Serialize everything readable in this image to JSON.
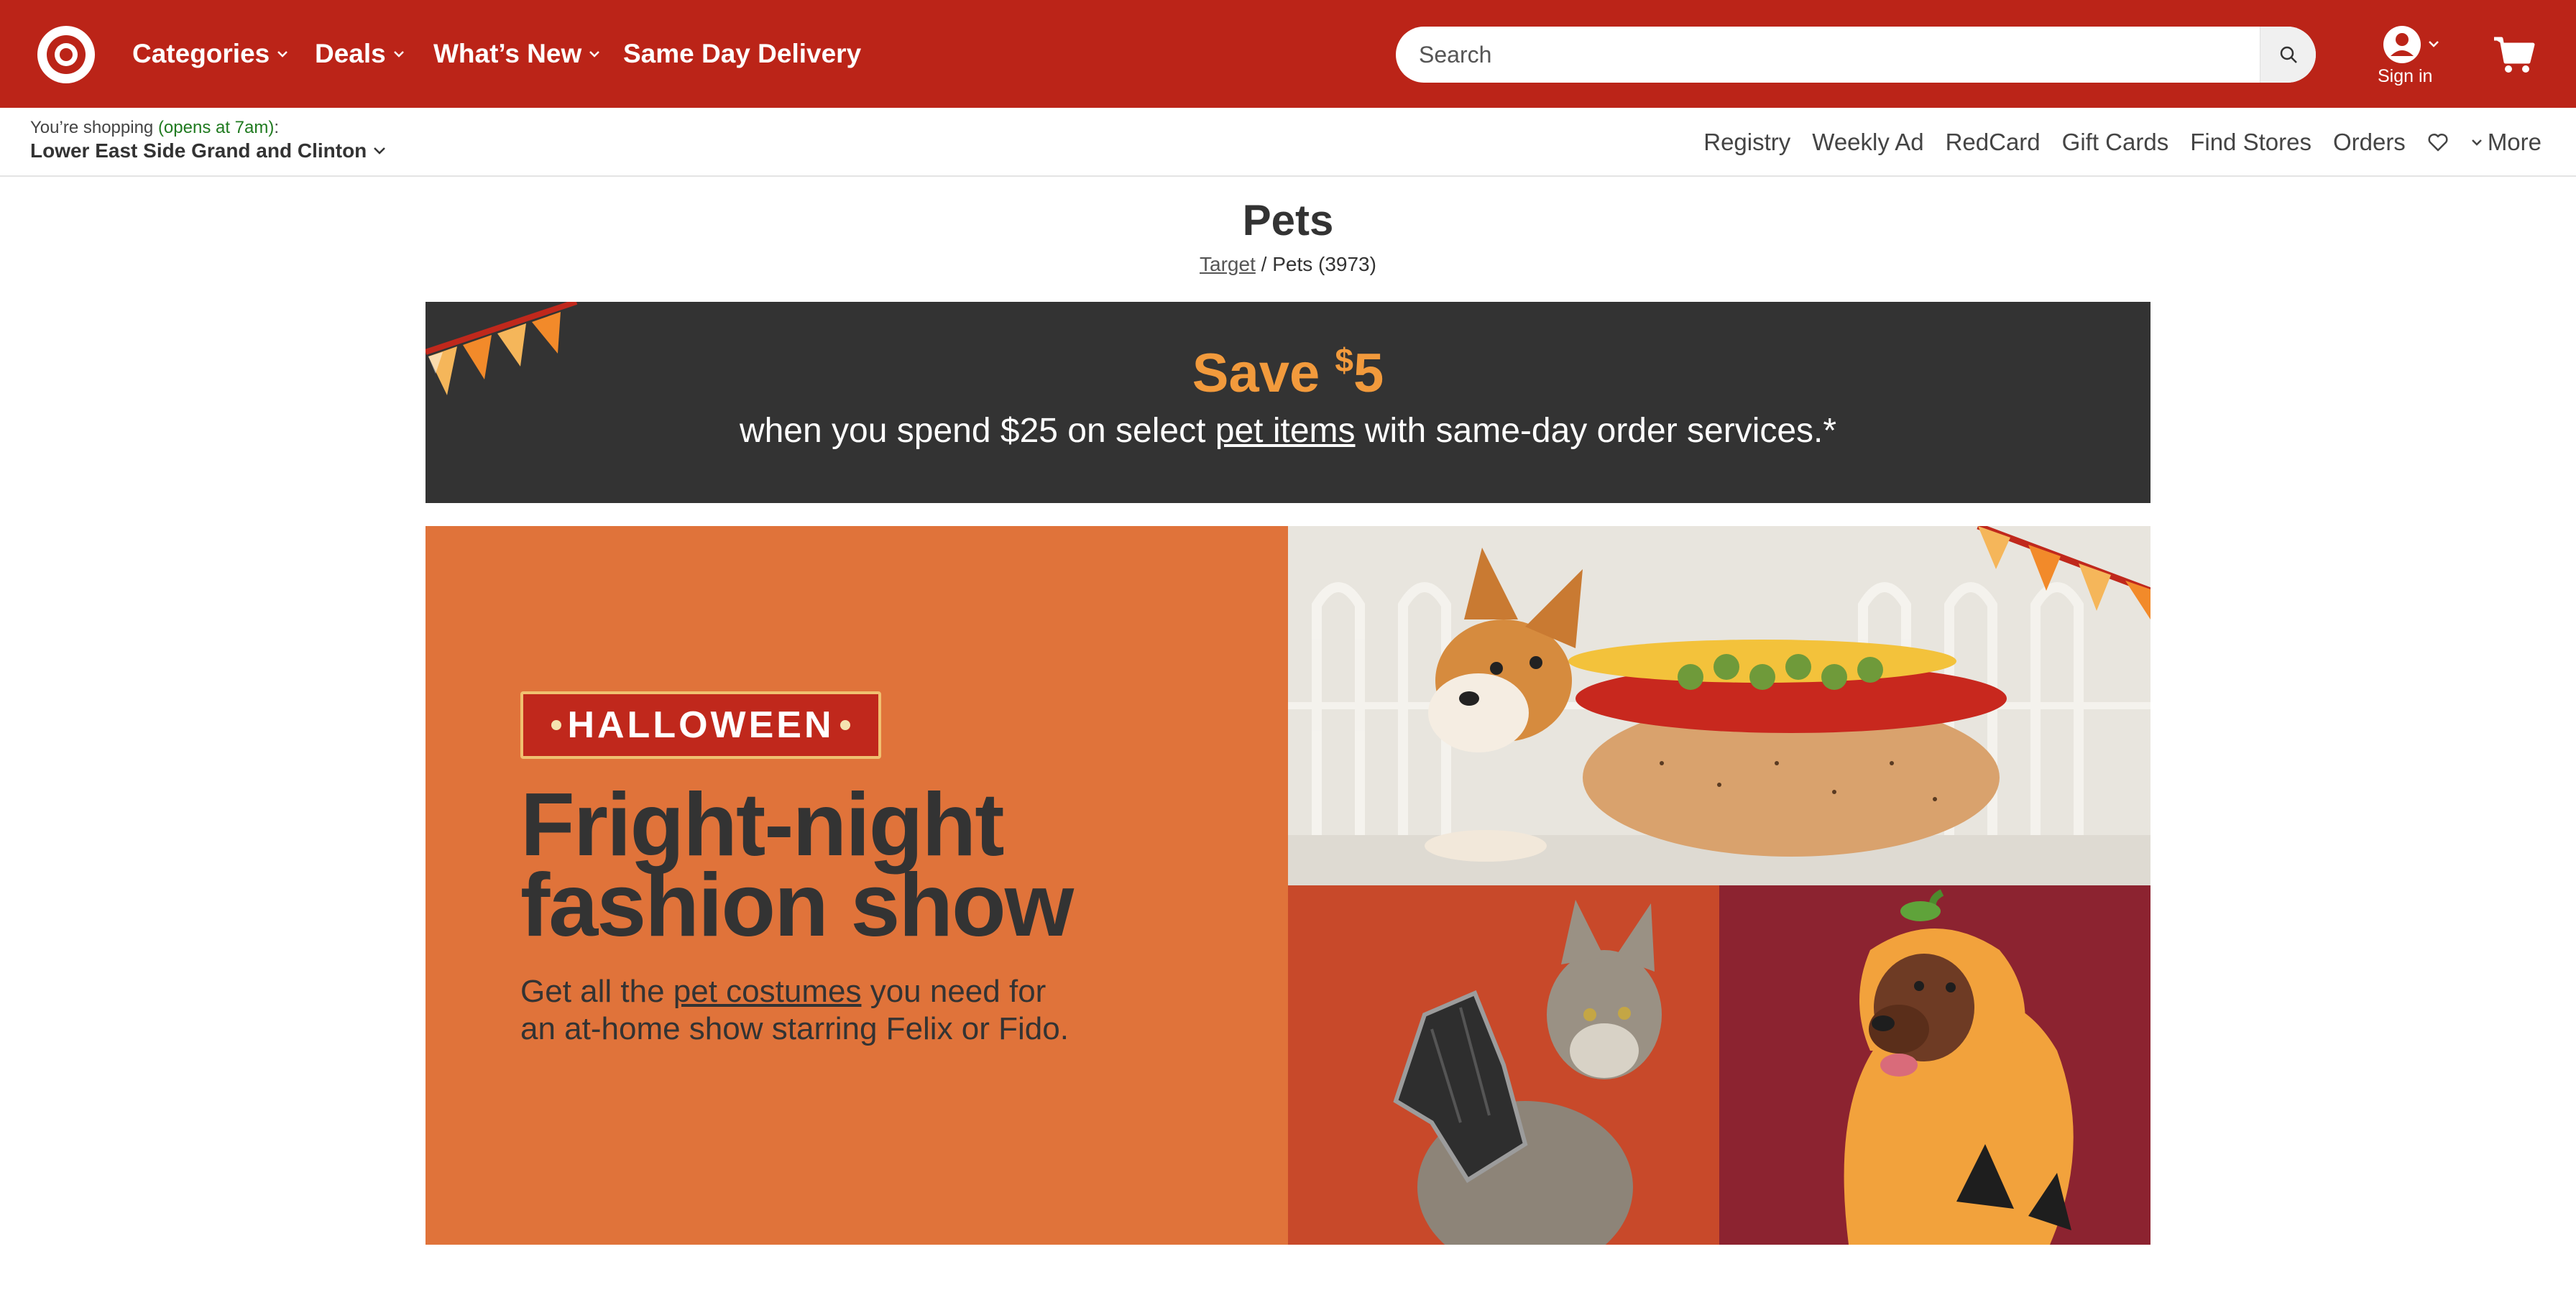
{
  "header": {
    "nav": [
      {
        "label": "Categories",
        "has_dropdown": true
      },
      {
        "label": "Deals",
        "has_dropdown": true
      },
      {
        "label": "What’s New",
        "has_dropdown": true
      },
      {
        "label": "Same Day Delivery",
        "has_dropdown": false
      }
    ],
    "search": {
      "placeholder": "Search"
    },
    "account": {
      "label": "Sign in"
    },
    "colors": {
      "brand_red": "#bb2418"
    }
  },
  "subbar": {
    "store_prefix": "You’re shopping ",
    "store_hours": "(opens at 7am)",
    "store_suffix": ":",
    "store_name": "Lower East Side Grand and Clinton",
    "links": [
      "Registry",
      "Weekly Ad",
      "RedCard",
      "Gift Cards",
      "Find Stores",
      "Orders"
    ],
    "more_label": "More"
  },
  "page": {
    "title": "Pets",
    "breadcrumb_root": "Target",
    "breadcrumb_sep": " / ",
    "breadcrumb_current": "Pets (3973)"
  },
  "promo": {
    "headline_prefix": "Save ",
    "headline_currency": "$",
    "headline_amount": "5",
    "sub_before": "when you spend $25 on select ",
    "sub_link": "pet items",
    "sub_after": " with same-day order services.*",
    "colors": {
      "background": "#333333",
      "headline": "#f29a3c"
    }
  },
  "hero": {
    "badge": "HALLOWEEN",
    "title_line1": "Fright-night",
    "title_line2": "fashion show",
    "copy_before": "Get all the ",
    "copy_link": "pet costumes",
    "copy_after_line1": " you need for",
    "copy_line2": "an at-home show starring Felix or Fido.",
    "colors": {
      "panel": "#e0733a",
      "tile_cat": "#c8492a",
      "tile_dog": "#8c2330"
    }
  }
}
